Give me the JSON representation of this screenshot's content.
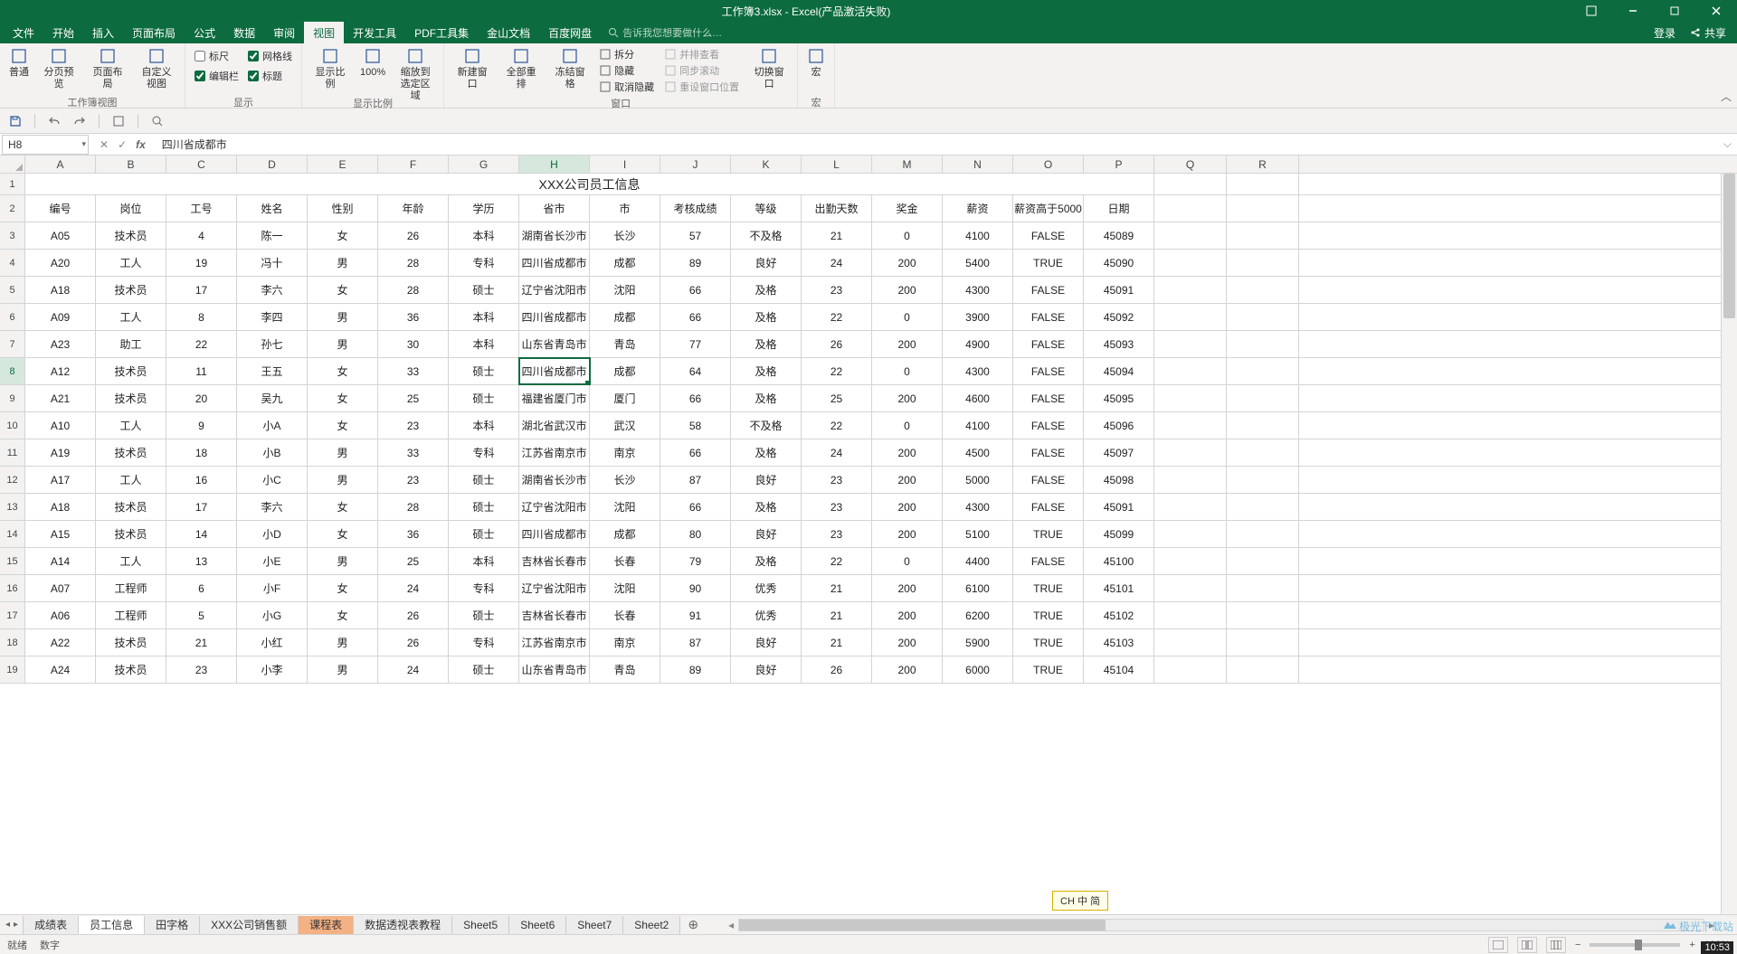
{
  "titlebar": {
    "title": "工作簿3.xlsx - Excel(产品激活失败)"
  },
  "menuTabs": [
    "文件",
    "开始",
    "插入",
    "页面布局",
    "公式",
    "数据",
    "审阅",
    "视图",
    "开发工具",
    "PDF工具集",
    "金山文档",
    "百度网盘"
  ],
  "activeMenu": 7,
  "tellMe": "告诉我您想要做什么…",
  "login": "登录",
  "share": "共享",
  "ribbon": {
    "group1": {
      "btns": [
        "普通",
        "分页预览",
        "页面布局",
        "自定义视图"
      ],
      "title": "工作簿视图"
    },
    "group2": {
      "checks": [
        [
          "标尺",
          false
        ],
        [
          "编辑栏",
          true
        ],
        [
          "网格线",
          true
        ],
        [
          "标题",
          true
        ]
      ],
      "title": "显示"
    },
    "group3": {
      "btns": [
        "显示比例",
        "100%",
        "缩放到选定区域"
      ],
      "title": "显示比例"
    },
    "group4": {
      "btns": [
        "新建窗口",
        "全部重排",
        "冻结窗格"
      ],
      "sub": [
        "拆分",
        "隐藏",
        "取消隐藏"
      ],
      "sub2": [
        "并排查看",
        "同步滚动",
        "重设窗口位置"
      ],
      "btns2": [
        "切换窗口"
      ],
      "title": "窗口"
    },
    "group5": {
      "btns": [
        "宏"
      ],
      "title": "宏"
    }
  },
  "nameBox": "H8",
  "formula": "四川省成都市",
  "columns": [
    "A",
    "B",
    "C",
    "D",
    "E",
    "F",
    "G",
    "H",
    "I",
    "J",
    "K",
    "L",
    "M",
    "N",
    "O",
    "P",
    "Q",
    "R"
  ],
  "selectedCol": "H",
  "selectedRow": 8,
  "titleRowText": "XXX公司员工信息",
  "headerRow": [
    "编号",
    "岗位",
    "工号",
    "姓名",
    "性别",
    "年龄",
    "学历",
    "省市",
    "市",
    "考核成绩",
    "等级",
    "出勤天数",
    "奖金",
    "薪资",
    "薪资高于5000",
    "日期"
  ],
  "dataRows": [
    [
      "A05",
      "技术员",
      "4",
      "陈一",
      "女",
      "26",
      "本科",
      "湖南省长沙市",
      "长沙",
      "57",
      "不及格",
      "21",
      "0",
      "4100",
      "FALSE",
      "45089"
    ],
    [
      "A20",
      "工人",
      "19",
      "冯十",
      "男",
      "28",
      "专科",
      "四川省成都市",
      "成都",
      "89",
      "良好",
      "24",
      "200",
      "5400",
      "TRUE",
      "45090"
    ],
    [
      "A18",
      "技术员",
      "17",
      "李六",
      "女",
      "28",
      "硕士",
      "辽宁省沈阳市",
      "沈阳",
      "66",
      "及格",
      "23",
      "200",
      "4300",
      "FALSE",
      "45091"
    ],
    [
      "A09",
      "工人",
      "8",
      "李四",
      "男",
      "36",
      "本科",
      "四川省成都市",
      "成都",
      "66",
      "及格",
      "22",
      "0",
      "3900",
      "FALSE",
      "45092"
    ],
    [
      "A23",
      "助工",
      "22",
      "孙七",
      "男",
      "30",
      "本科",
      "山东省青岛市",
      "青岛",
      "77",
      "及格",
      "26",
      "200",
      "4900",
      "FALSE",
      "45093"
    ],
    [
      "A12",
      "技术员",
      "11",
      "王五",
      "女",
      "33",
      "硕士",
      "四川省成都市",
      "成都",
      "64",
      "及格",
      "22",
      "0",
      "4300",
      "FALSE",
      "45094"
    ],
    [
      "A21",
      "技术员",
      "20",
      "吴九",
      "女",
      "25",
      "硕士",
      "福建省厦门市",
      "厦门",
      "66",
      "及格",
      "25",
      "200",
      "4600",
      "FALSE",
      "45095"
    ],
    [
      "A10",
      "工人",
      "9",
      "小A",
      "女",
      "23",
      "本科",
      "湖北省武汉市",
      "武汉",
      "58",
      "不及格",
      "22",
      "0",
      "4100",
      "FALSE",
      "45096"
    ],
    [
      "A19",
      "技术员",
      "18",
      "小B",
      "男",
      "33",
      "专科",
      "江苏省南京市",
      "南京",
      "66",
      "及格",
      "24",
      "200",
      "4500",
      "FALSE",
      "45097"
    ],
    [
      "A17",
      "工人",
      "16",
      "小C",
      "男",
      "23",
      "硕士",
      "湖南省长沙市",
      "长沙",
      "87",
      "良好",
      "23",
      "200",
      "5000",
      "FALSE",
      "45098"
    ],
    [
      "A18",
      "技术员",
      "17",
      "李六",
      "女",
      "28",
      "硕士",
      "辽宁省沈阳市",
      "沈阳",
      "66",
      "及格",
      "23",
      "200",
      "4300",
      "FALSE",
      "45091"
    ],
    [
      "A15",
      "技术员",
      "14",
      "小D",
      "女",
      "36",
      "硕士",
      "四川省成都市",
      "成都",
      "80",
      "良好",
      "23",
      "200",
      "5100",
      "TRUE",
      "45099"
    ],
    [
      "A14",
      "工人",
      "13",
      "小E",
      "男",
      "25",
      "本科",
      "吉林省长春市",
      "长春",
      "79",
      "及格",
      "22",
      "0",
      "4400",
      "FALSE",
      "45100"
    ],
    [
      "A07",
      "工程师",
      "6",
      "小F",
      "女",
      "24",
      "专科",
      "辽宁省沈阳市",
      "沈阳",
      "90",
      "优秀",
      "21",
      "200",
      "6100",
      "TRUE",
      "45101"
    ],
    [
      "A06",
      "工程师",
      "5",
      "小G",
      "女",
      "26",
      "硕士",
      "吉林省长春市",
      "长春",
      "91",
      "优秀",
      "21",
      "200",
      "6200",
      "TRUE",
      "45102"
    ],
    [
      "A22",
      "技术员",
      "21",
      "小红",
      "男",
      "26",
      "专科",
      "江苏省南京市",
      "南京",
      "87",
      "良好",
      "21",
      "200",
      "5900",
      "TRUE",
      "45103"
    ],
    [
      "A24",
      "技术员",
      "23",
      "小李",
      "男",
      "24",
      "硕士",
      "山东省青岛市",
      "青岛",
      "89",
      "良好",
      "26",
      "200",
      "6000",
      "TRUE",
      "45104"
    ]
  ],
  "sheetTabs": [
    "成绩表",
    "员工信息",
    "田字格",
    "XXX公司销售额",
    "课程表",
    "数据透视表教程",
    "Sheet5",
    "Sheet6",
    "Sheet7",
    "Sheet2"
  ],
  "activeSheet": 1,
  "orangeSheet": 4,
  "status": {
    "left1": "就绪",
    "left2": "数字"
  },
  "zoomPct": "100%",
  "imeHint": "CH 中 简",
  "clock": "10:53",
  "watermark": "极光下载站"
}
